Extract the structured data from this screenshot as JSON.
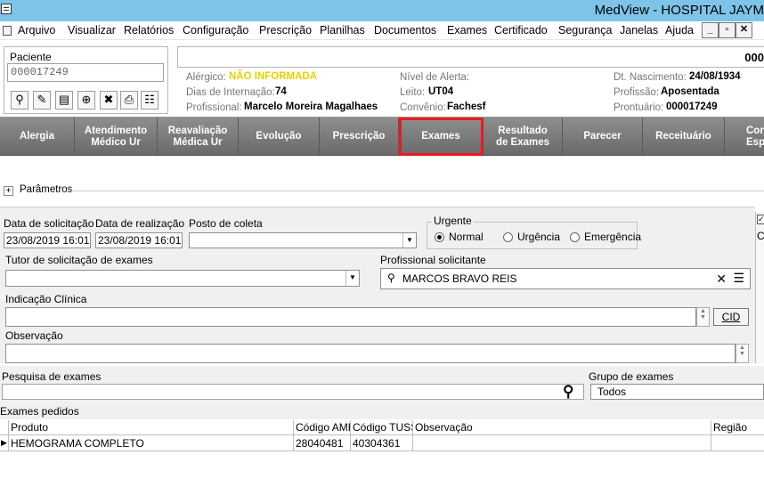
{
  "window": {
    "title": "MedView - HOSPITAL JAYM"
  },
  "menu": {
    "items": [
      "Arquivo",
      "Visualizar",
      "Relatórios",
      "Configuração",
      "Prescrição",
      "Planilhas",
      "Documentos",
      "Exames",
      "Certificado",
      "Segurança",
      "Janelas",
      "Ajuda"
    ],
    "window_buttons": [
      "_",
      "▫",
      "✕"
    ]
  },
  "patient": {
    "label": "Paciente",
    "id_value": "000017249",
    "code_display": "000"
  },
  "info": {
    "alergico_label": "Alérgico:",
    "alergico_value": "NÃO INFORMADA",
    "dias_label": "Dias de Internação:",
    "dias_value": "74",
    "profissional_label": "Profissional:",
    "profissional_value": "Marcelo Moreira Magalhaes",
    "nivel_label": "Nível de Alerta:",
    "nivel_value": "",
    "leito_label": "Leito:",
    "leito_value": "UT04",
    "convenio_label": "Convênio:",
    "convenio_value": "Fachesf",
    "nasc_label": "Dt. Nascimento:",
    "nasc_value": "24/08/1934",
    "profissao_label": "Profissão:",
    "profissao_value": "Aposentada",
    "prontuario_label": "Prontuário:",
    "prontuario_value": "000017249"
  },
  "tabs": [
    {
      "line1": "Alergia",
      "line2": ""
    },
    {
      "line1": "Atendimento",
      "line2": "Médico Ur"
    },
    {
      "line1": "Reavaliação",
      "line2": "Médica Ur"
    },
    {
      "line1": "Evolução",
      "line2": ""
    },
    {
      "line1": "Prescrição",
      "line2": ""
    },
    {
      "line1": "Exames",
      "line2": ""
    },
    {
      "line1": "Resultado",
      "line2": "de Exames"
    },
    {
      "line1": "Parecer",
      "line2": ""
    },
    {
      "line1": "Receituário",
      "line2": ""
    },
    {
      "line1": "Cont",
      "line2": "Espe"
    }
  ],
  "active_tab": "Exames",
  "params": {
    "label": "Parâmetros",
    "toggle": "+"
  },
  "form": {
    "data_solicitacao_label": "Data de solicitação",
    "data_solicitacao_value": "23/08/2019 16:01",
    "data_realizacao_label": "Data de realização",
    "data_realizacao_value": "23/08/2019 16:01",
    "posto_label": "Posto de coleta",
    "posto_value": "",
    "urgente_label": "Urgente",
    "urgente_options": [
      "Normal",
      "Urgência",
      "Emergência"
    ],
    "urgente_selected": "Normal",
    "tutor_label": "Tutor de solicitação de exames",
    "tutor_value": "",
    "profissional_label": "Profissional solicitante",
    "profissional_value": "MARCOS BRAVO REIS",
    "indicacao_label": "Indicação Clínica",
    "indicacao_value": "",
    "cid_button": "CID",
    "observacao_label": "Observação",
    "observacao_value": "",
    "side_clip_label": "Cl"
  },
  "search": {
    "pesquisa_label": "Pesquisa de exames",
    "pesquisa_value": "",
    "grupo_label": "Grupo de exames",
    "grupo_value": "Todos",
    "pedidos_label": "Exames pedidos"
  },
  "grid": {
    "columns": [
      "Produto",
      "Código AMB",
      "Código TUSS",
      "Observação",
      "Região"
    ],
    "rows": [
      {
        "produto": "HEMOGRAMA COMPLETO",
        "amb": "28040481",
        "tuss": "40304361",
        "obs": "",
        "regiao": ""
      }
    ]
  }
}
